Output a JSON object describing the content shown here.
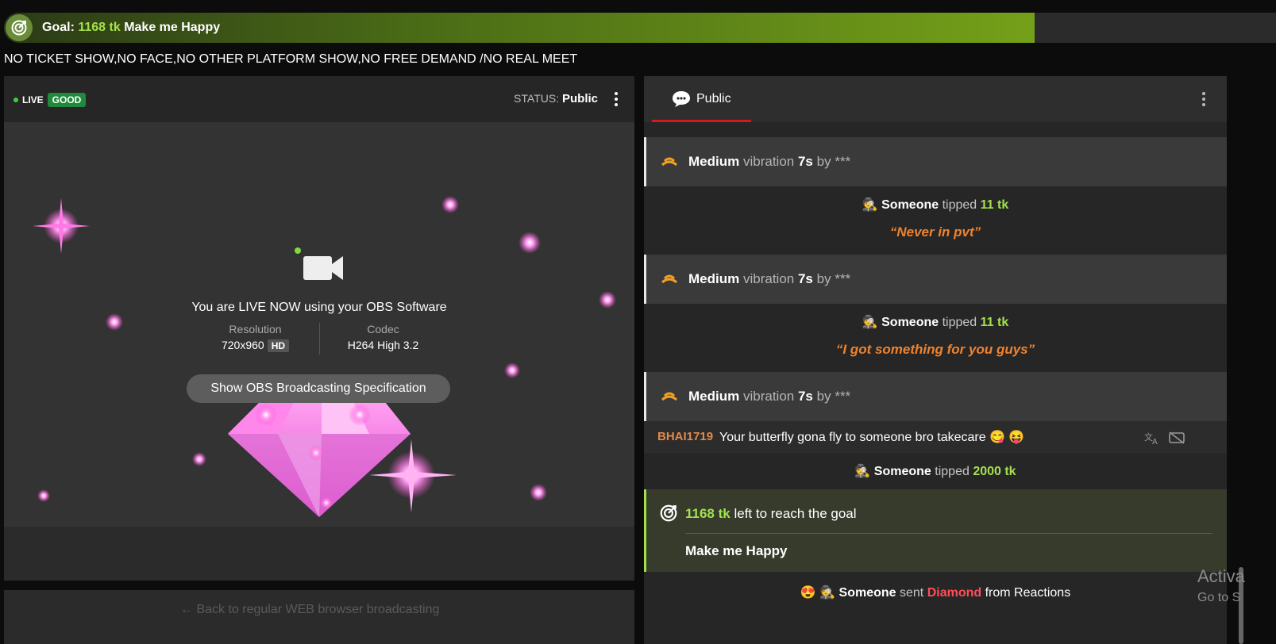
{
  "goal": {
    "label": "Goal:",
    "amount": "1168 tk",
    "title": "Make me Happy",
    "progress_percent": 81.3
  },
  "notice": "NO TICKET SHOW,NO FACE,NO OTHER PLATFORM SHOW,NO FREE DEMAND /NO REAL MEET",
  "stream": {
    "live_label": "LIVE",
    "quality_badge": "GOOD",
    "status_label": "STATUS:",
    "status_value": "Public",
    "live_message": "You are LIVE NOW using your OBS Software",
    "resolution_label": "Resolution",
    "resolution_value": "720x960",
    "resolution_badge": "HD",
    "codec_label": "Codec",
    "codec_value": "H264 High 3.2",
    "obs_button": "Show OBS Broadcasting Specification",
    "back_link": "Back to regular WEB browser broadcasting"
  },
  "chat": {
    "tab": "Public",
    "vibration": {
      "level": "Medium",
      "word": "vibration",
      "duration": "7s",
      "by": "by",
      "user": "***"
    },
    "tip_user": "Someone",
    "tip_word": "tipped",
    "tips": [
      {
        "amount": "11 tk",
        "quote": "“Never in pvt”"
      },
      {
        "amount": "11 tk",
        "quote": "“I got something for you guys”"
      },
      {
        "amount": "2000 tk"
      }
    ],
    "message": {
      "user": "BHAI1719",
      "text": "Your butterfly gona fly to someone bro takecare 😋 😝"
    },
    "goal_left": {
      "amount": "1168 tk",
      "text": "left to reach the goal",
      "title": "Make me Happy"
    },
    "reaction": {
      "emoji": "😍",
      "user": "Someone",
      "word": "sent",
      "item": "Diamond",
      "suffix": "from Reactions"
    }
  },
  "watermark": {
    "line1": "Activa",
    "line2": "Go to S"
  },
  "colors": {
    "accent_green": "#a4e04c",
    "quote_orange": "#f0832e",
    "tab_red": "#d01c1c",
    "diamond_red": "#ff4d5a"
  }
}
